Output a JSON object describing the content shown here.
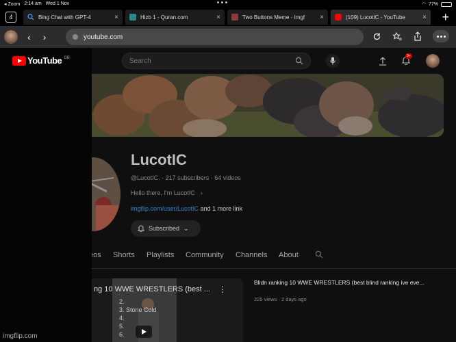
{
  "status_bar": {
    "zoom_label": "Zoom",
    "time": "2:14 am",
    "date": "Wed 1 Nov",
    "battery": "77%",
    "battery_level": 0.77
  },
  "browser": {
    "tab_count": "4",
    "tabs": [
      {
        "label": "Bing Chat with GPT-4",
        "active": false
      },
      {
        "label": "Hizb 1 - Quran.com",
        "active": false
      },
      {
        "label": "Two Buttons Meme - Imgf",
        "active": false
      },
      {
        "label": "(109) LucotIC - YouTube",
        "active": true
      }
    ],
    "url": "youtube.com",
    "back_glyph": "‹",
    "forward_glyph": "›",
    "new_tab_glyph": "+",
    "accent": "#3b82d6"
  },
  "youtube": {
    "logo_text": "YouTube",
    "country_code": "GB",
    "search_placeholder": "Search",
    "notification_count": "9+",
    "channel": {
      "name": "LucotIC",
      "handle": "@LucotIC.",
      "subscribers": "217 subscribers",
      "videos": "64 videos",
      "description": "Hello there, I'm LucotIC",
      "link_url": "imgflip.com/user/LucotIC",
      "link_suffix": "and 1 more link",
      "subscribed_label": "Subscribed"
    },
    "tabs": [
      "eos",
      "Shorts",
      "Playlists",
      "Community",
      "Channels",
      "About"
    ],
    "video": {
      "thumb_title": "ng 10 WWE WRESTLERS (best ...",
      "thumb_list": [
        "2.",
        "3. Stone Cold",
        "4.",
        "5.",
        "6."
      ],
      "title": "Blidn ranking 10 WWE WRESTLERS (best blind ranking ive eve...",
      "views": "225 views",
      "age": "2 days ago"
    }
  },
  "watermark": "imgflip.com"
}
